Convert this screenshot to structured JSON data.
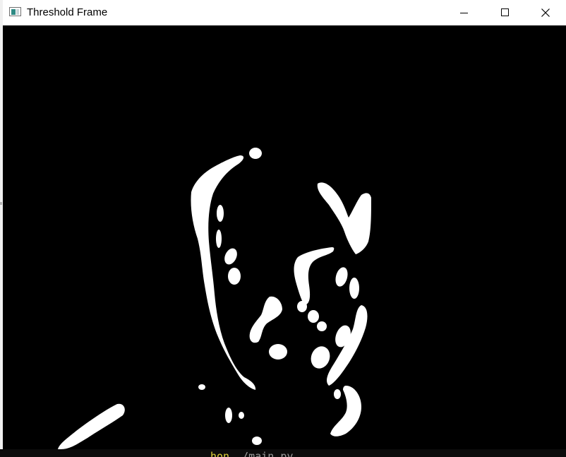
{
  "window": {
    "title": "Threshold Frame",
    "controls": {
      "minimize": "minimize-icon",
      "maximize": "maximize-icon",
      "close": "close-icon"
    }
  },
  "frame": {
    "background_color": "#000000",
    "foreground_color": "#ffffff"
  },
  "terminal": {
    "command": "hon",
    "argument": " ./main.py",
    "command_color": "#e0d23a",
    "argument_color": "#9a9a9a"
  }
}
